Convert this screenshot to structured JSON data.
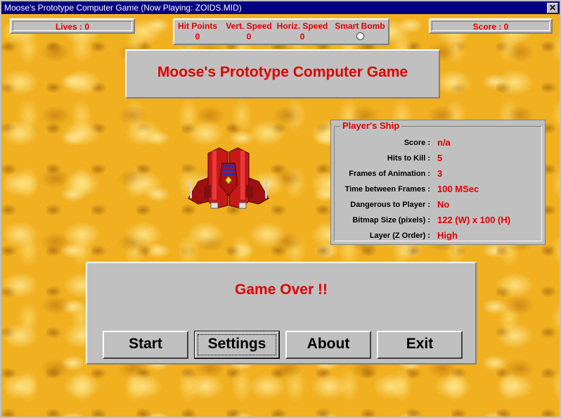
{
  "window": {
    "title": "Moose's Prototype Computer Game   (Now Playing: ZOIDS.MID)",
    "close_glyph": "✕"
  },
  "hud": {
    "lives": "Lives : 0",
    "score": "Score : 0",
    "stats": [
      {
        "label": "Hit Points",
        "value": "0"
      },
      {
        "label": "Vert. Speed",
        "value": "0"
      },
      {
        "label": "Horiz. Speed",
        "value": "0"
      },
      {
        "label": "Smart Bomb",
        "value": ""
      }
    ]
  },
  "banner": {
    "title": "Moose's Prototype Computer Game"
  },
  "players_ship": {
    "heading": "Player's Ship",
    "rows": [
      {
        "key": "Score :",
        "value": "n/a"
      },
      {
        "key": "Hits to Kill :",
        "value": "5"
      },
      {
        "key": "Frames of Animation :",
        "value": "3"
      },
      {
        "key": "Time between Frames :",
        "value": "100 MSec"
      },
      {
        "key": "Dangerous to Player :",
        "value": "No"
      },
      {
        "key": "Bitmap Size (pixels) :",
        "value": "122 (W) x 100 (H)"
      },
      {
        "key": "Layer (Z Order) :",
        "value": "High"
      }
    ]
  },
  "main": {
    "status": "Game Over !!",
    "buttons": {
      "start": "Start",
      "settings": "Settings",
      "about": "About",
      "exit": "Exit"
    }
  },
  "colors": {
    "accent_text": "#e00000",
    "panel": "#c0c0c0",
    "titlebar": "#000080",
    "background": "#f0b020"
  }
}
